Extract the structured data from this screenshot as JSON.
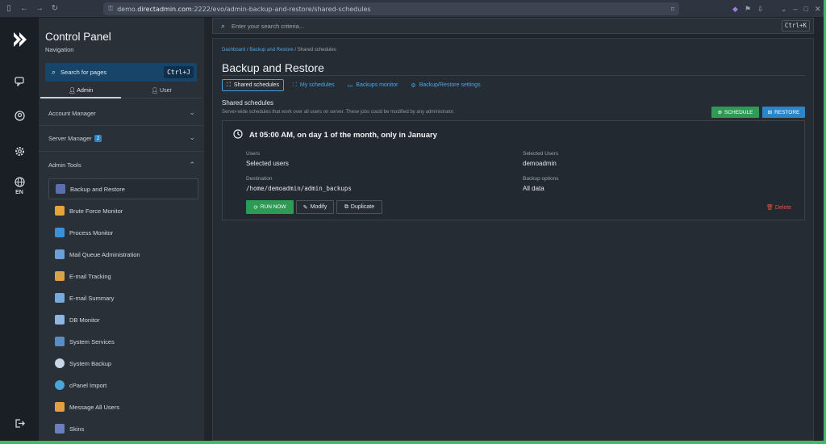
{
  "browser": {
    "url_prefix": "demo.",
    "url_host": "directadmin.com",
    "url_rest": ":2222/evo/admin-backup-and-restore/shared-schedules"
  },
  "rail": {
    "lang": "EN"
  },
  "sidebar": {
    "title": "Control Panel",
    "subtitle": "Navigation",
    "search_label": "Search for pages",
    "search_shortcut": "Ctrl+J",
    "tabs": [
      "Admin",
      "User"
    ],
    "sections": [
      {
        "label": "Account Manager",
        "badge": ""
      },
      {
        "label": "Server Manager",
        "badge": "2"
      },
      {
        "label": "Admin Tools",
        "badge": ""
      }
    ],
    "items": [
      {
        "label": "Backup and Restore",
        "color": "#5b6fb0"
      },
      {
        "label": "Brute Force Monitor",
        "color": "#e8a23a"
      },
      {
        "label": "Process Monitor",
        "color": "#3d8fd6"
      },
      {
        "label": "Mail Queue Administration",
        "color": "#6a9fd8"
      },
      {
        "label": "E-mail Tracking",
        "color": "#d8a24a"
      },
      {
        "label": "E-mail Summary",
        "color": "#7aa8d8"
      },
      {
        "label": "DB Monitor",
        "color": "#8fb6e0"
      },
      {
        "label": "System Services",
        "color": "#5d8cc2"
      },
      {
        "label": "System Backup",
        "color": "#c9d6e6"
      },
      {
        "label": "cPanel Import",
        "color": "#4aa6d8"
      },
      {
        "label": "Message All Users",
        "color": "#e0a040"
      },
      {
        "label": "Skins",
        "color": "#6a7fc2"
      }
    ]
  },
  "main": {
    "search_placeholder": "Enter your search criteria...",
    "search_shortcut": "Ctrl+K",
    "breadcrumb": [
      "Dashboard",
      "Backup and Restore",
      "Shared schedules"
    ],
    "page_title": "Backup and Restore",
    "tabs": [
      "Shared schedules",
      "My schedules",
      "Backups monitor",
      "Backup/Restore settings"
    ],
    "section_title": "Shared schedules",
    "section_desc": "Server-wide schedules that work over all users on server. These jobs could be modified by any administrator.",
    "btn_schedule": "SCHEDULE",
    "btn_restore": "RESTORE",
    "card": {
      "time": "At 05:00 AM, on day 1 of the month, only in January",
      "users_label": "Users",
      "users_value": "Selected users",
      "selected_users_label": "Selected Users",
      "selected_users_value": "demoadmin",
      "destination_label": "Destination",
      "destination_value": "/home/demoadmin/admin_backups",
      "backup_options_label": "Backup options",
      "backup_options_value": "All data",
      "run_now": "RUN NOW",
      "modify": "Modify",
      "duplicate": "Duplicate",
      "delete": "Delete"
    }
  }
}
